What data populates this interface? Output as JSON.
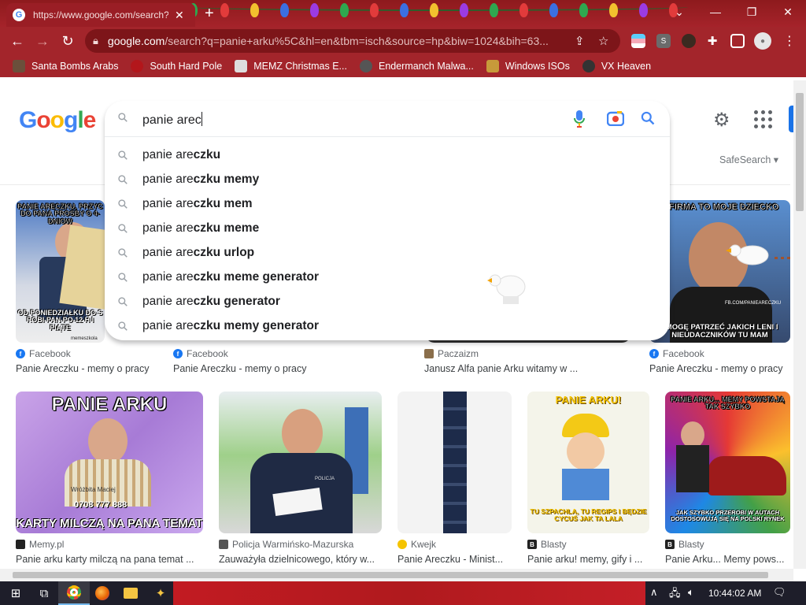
{
  "browser": {
    "tab_title": "https://www.google.com/search?",
    "url_host": "google.com",
    "url_path": "/search?q=panie+arku%5C&hl=en&tbm=isch&source=hp&biw=1024&bih=63...",
    "bookmarks": [
      {
        "label": "Santa Bombs Arabs",
        "icon": "hand-icon",
        "color": "#6b4f3b"
      },
      {
        "label": "South Hard Pole",
        "icon": "flower-icon",
        "color": "#b3161b"
      },
      {
        "label": "MEMZ Christmas E...",
        "icon": "page-icon",
        "color": "#dddddd"
      },
      {
        "label": "Endermanch Malwa...",
        "icon": "cat-icon",
        "color": "#555555"
      },
      {
        "label": "Windows ISOs",
        "icon": "figure-icon",
        "color": "#c79a3a"
      },
      {
        "label": "VX Heaven",
        "icon": "spider-icon",
        "color": "#333333"
      }
    ]
  },
  "search": {
    "query": "panie arec",
    "safesearch_label": "SafeSearch",
    "suggestions": [
      {
        "prefix": "panie are",
        "bold": "czku"
      },
      {
        "prefix": "panie are",
        "bold": "czku memy"
      },
      {
        "prefix": "panie are",
        "bold": "czku mem"
      },
      {
        "prefix": "panie are",
        "bold": "czku meme"
      },
      {
        "prefix": "panie are",
        "bold": "czku urlop"
      },
      {
        "prefix": "panie are",
        "bold": "czku meme generator"
      },
      {
        "prefix": "panie are",
        "bold": "czku generator"
      },
      {
        "prefix": "panie are",
        "bold": "czku memy generator"
      }
    ]
  },
  "results": {
    "row1": [
      {
        "source": "Facebook",
        "caption": "Panie Areczku - memy o pracy",
        "top_text": "PANIE ARECZKU, PRZYC DO PANA PROŚBY O 4-DNIOW",
        "bottom_text": "OD PONIEDZIAŁKU DO S ROBI PAN PO 12 H I PIĄTE",
        "watermark": "memeszkola"
      },
      {
        "source": "Facebook",
        "caption": "Panie Areczku - memy o pracy"
      },
      {
        "source": "Paczaizm",
        "caption": "Janusz Alfa panie Arku witamy w ..."
      },
      {
        "source": "Facebook",
        "caption": "Panie Areczku - memy o pracy",
        "top_text": "A FIRMA TO MOJE DZIECKO",
        "bottom_text": "I MOGĘ PATRZEĆ JAKICH LENI I NIEUDACZNIKÓW TU MAM",
        "watermark": "FB.COM/PANIEARECZKU"
      }
    ],
    "row2": [
      {
        "source": "Memy.pl",
        "caption": "Panie arku karty milczą na pana temat ...",
        "top_text": "PANIE ARKU",
        "bottom_text": "KARTY MILCZĄ NA PANA TEMAT",
        "phone": "0708 777 888",
        "name": "Wróżbita Maciej"
      },
      {
        "source": "Policja Warmińsko-Mazurska",
        "caption": "Zauważyła dzielnicowego, który w...",
        "badge": "POLICJA"
      },
      {
        "source": "Kwejk",
        "caption": "Panie Areczku - Minist..."
      },
      {
        "source": "Blasty",
        "caption": "Panie arku! memy, gify i ...",
        "top_text": "PANIE ARKU!",
        "bottom_text": "TU SZPACHLA, TU REGIPS I BĘDZIE CYCUŚ JAK TA LALA"
      },
      {
        "source": "Blasty",
        "caption": "Panie Arku... Memy pows...",
        "top_text": "PANIE ARKU... MEMY POWSTAJĄ TAK SZYBKO",
        "bottom_text": "JAK SZYBKO PRZEROBI W AUTACH DOSTOSOWUJĄ SIĘ NA POLSKI RYNEK"
      }
    ]
  },
  "taskbar": {
    "clock": "10:44:02 AM"
  },
  "colors": {
    "chrome_red": "#a3252b",
    "google_blue": "#4285f4",
    "google_red": "#ea4335",
    "google_yellow": "#fbbc05",
    "google_green": "#34a853"
  }
}
